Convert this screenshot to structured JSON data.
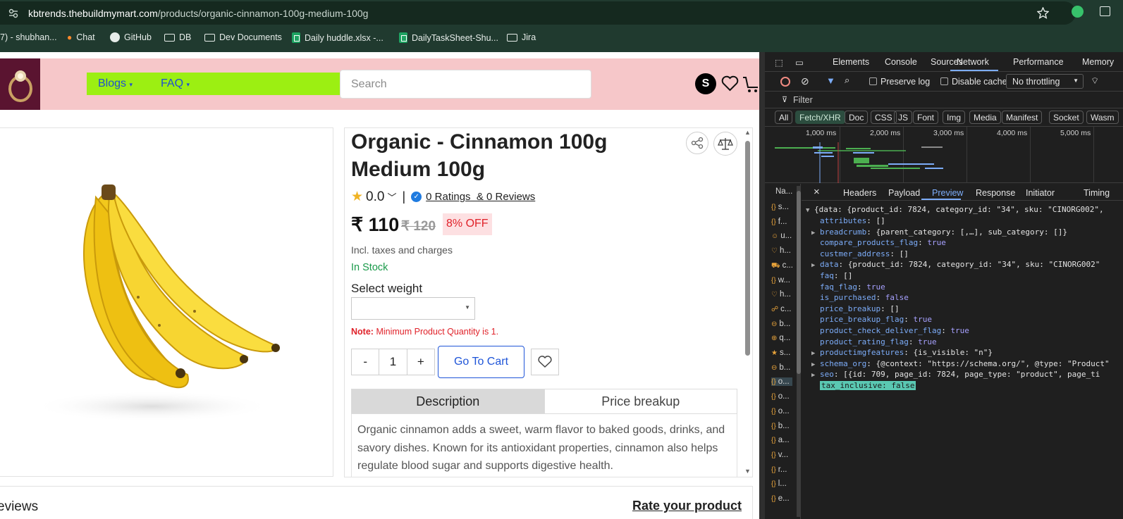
{
  "browser": {
    "url_domain": "kbtrends.thebuildmymart.com",
    "url_path": "/products/organic-cinnamon-100g-medium-100g",
    "bookmarks": [
      "7) - shubhan...",
      "Chat",
      "GitHub",
      "DB",
      "Dev Documents",
      "Daily huddle.xlsx -...",
      "DailyTaskSheet-Shu...",
      "Jira"
    ]
  },
  "site": {
    "nav": [
      "Blogs",
      "FAQ"
    ],
    "search_placeholder": "Search",
    "avatar_letter": "S",
    "colors": {
      "header_bg": "#f6c7c9",
      "nav_bg": "#9cef12",
      "link": "#1f4fd0"
    }
  },
  "product": {
    "title": "Organic - Cinnamon 100g Medium 100g",
    "rating": "0.0",
    "ratings_link": "0 Ratings  & 0 Reviews",
    "price": "₹ 110",
    "mrp": "₹ 120",
    "discount": "8% OFF",
    "tax_note": "Incl. taxes and charges",
    "stock": "In Stock",
    "select_weight_label": "Select weight",
    "note_label": "Note:",
    "note_text": "Minimum Product Quantity is 1.",
    "qty_minus": "-",
    "qty_value": "1",
    "qty_plus": "+",
    "go_to_cart": "Go To Cart",
    "tabs": [
      "Description",
      "Price breakup"
    ],
    "description": "Organic cinnamon adds a sweet, warm flavor to baked goods, drinks, and savory dishes. Known for its antioxidant properties, cinnamon also helps regulate blood sugar and supports digestive health."
  },
  "reviews": {
    "title": "eviews",
    "rate_link": "Rate your product"
  },
  "devtools": {
    "tabs": [
      "Elements",
      "Console",
      "Sources",
      "Network",
      "Performance",
      "Memory"
    ],
    "active_tab": "Network",
    "preserve_log": "Preserve log",
    "disable_cache": "Disable cache",
    "throttling": "No throttling",
    "filter_placeholder": "Filter",
    "type_filters": [
      "All",
      "Fetch/XHR",
      "Doc",
      "CSS",
      "JS",
      "Font",
      "Img",
      "Media",
      "Manifest",
      "Socket",
      "Wasm"
    ],
    "active_type": "Fetch/XHR",
    "timeline_ticks": [
      "1,000 ms",
      "2,000 ms",
      "3,000 ms",
      "4,000 ms",
      "5,000 ms"
    ],
    "name_col": "Na...",
    "requests": [
      "s...",
      "f...",
      "u...",
      "h...",
      "c...",
      "w...",
      "h...",
      "c...",
      "b...",
      "q...",
      "s...",
      "b...",
      "o...",
      "o...",
      "o...",
      "b...",
      "a...",
      "v...",
      "r...",
      "l...",
      "e..."
    ],
    "detail_tabs": [
      "Headers",
      "Payload",
      "Preview",
      "Response",
      "Initiator",
      "Timing"
    ],
    "active_detail": "Preview",
    "preview": {
      "root": "{data: {product_id: 7824, category_id: \"34\", sku: \"CINORG002\",",
      "lines": [
        {
          "key": "attributes",
          "val": "[]",
          "expand": false
        },
        {
          "key": "breadcrumb",
          "val": "{parent_category: [,…], sub_category: []}",
          "expand": true
        },
        {
          "key": "compare_products_flag",
          "val": "true",
          "expand": false
        },
        {
          "key": "custmer_address",
          "val": "[]",
          "expand": false
        },
        {
          "key": "data",
          "val": "{product_id: 7824, category_id: \"34\", sku: \"CINORG002\"",
          "expand": true
        },
        {
          "key": "faq",
          "val": "[]",
          "expand": false
        },
        {
          "key": "faq_flag",
          "val": "true",
          "expand": false
        },
        {
          "key": "is_purchased",
          "val": "false",
          "expand": false
        },
        {
          "key": "price_breakup",
          "val": "[]",
          "expand": false
        },
        {
          "key": "price_breakup_flag",
          "val": "true",
          "expand": false
        },
        {
          "key": "product_check_deliver_flag",
          "val": "true",
          "expand": false
        },
        {
          "key": "product_rating_flag",
          "val": "true",
          "expand": false
        },
        {
          "key": "productimgfeatures",
          "val": "{is_visible: \"n\"}",
          "expand": true
        },
        {
          "key": "schema_org",
          "val": "{@context: \"https://schema.org/\", @type: \"Product\"",
          "expand": true
        },
        {
          "key": "seo",
          "val": "[{id: 709, page_id: 7824, page_type: \"product\", page_ti",
          "expand": true
        }
      ],
      "highlight": "tax_inclusive: false"
    }
  }
}
